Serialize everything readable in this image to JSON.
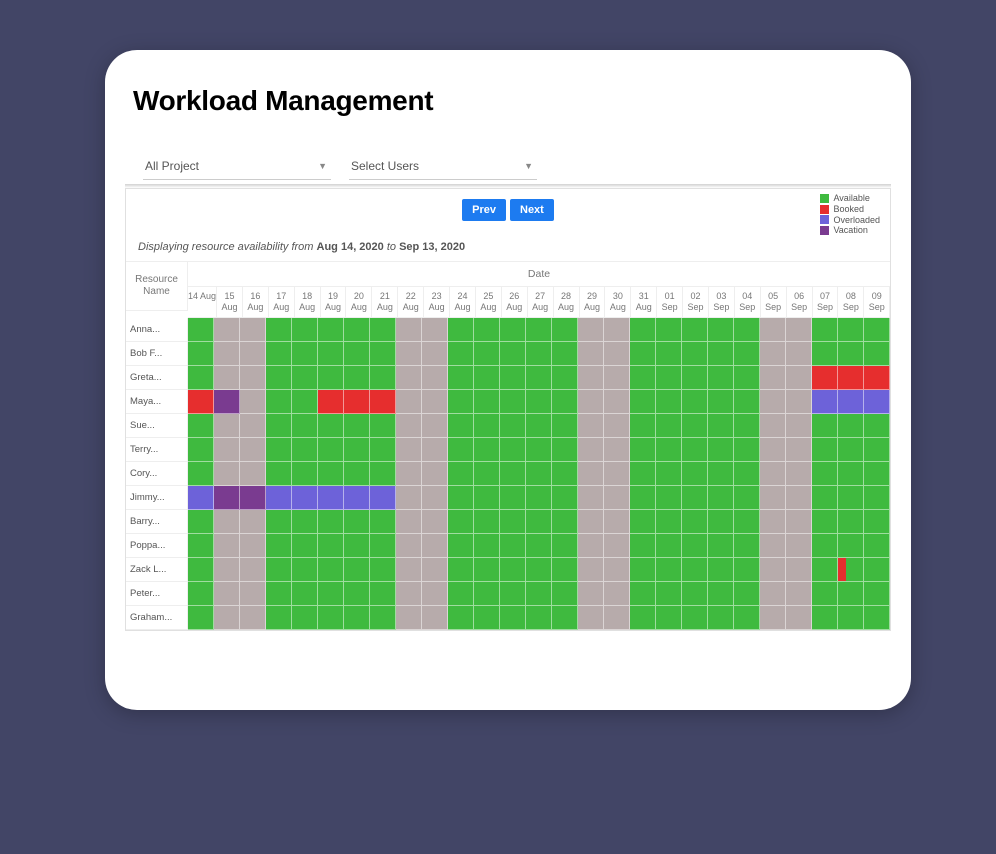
{
  "title": "Workload Management",
  "filters": {
    "project": {
      "label": "All Project"
    },
    "users": {
      "label": "Select Users"
    }
  },
  "nav": {
    "prev": "Prev",
    "next": "Next"
  },
  "legend": [
    {
      "label": "Available",
      "color": "#3fba3f"
    },
    {
      "label": "Booked",
      "color": "#e62e2e"
    },
    {
      "label": "Overloaded",
      "color": "#6d62d9"
    },
    {
      "label": "Vacation",
      "color": "#7a3b90"
    }
  ],
  "caption": {
    "prefix": "Displaying resource availability from ",
    "from": "Aug 14, 2020",
    "mid": " to ",
    "to": "Sep 13, 2020"
  },
  "headers": {
    "resource": "Resource Name",
    "date": "Date"
  },
  "dates": [
    "14 Aug",
    "15 Aug",
    "16 Aug",
    "17 Aug",
    "18 Aug",
    "19 Aug",
    "20 Aug",
    "21 Aug",
    "22 Aug",
    "23 Aug",
    "24 Aug",
    "25 Aug",
    "26 Aug",
    "27 Aug",
    "28 Aug",
    "29 Aug",
    "30 Aug",
    "31 Aug",
    "01 Sep",
    "02 Sep",
    "03 Sep",
    "04 Sep",
    "05 Sep",
    "06 Sep",
    "07 Sep",
    "08 Sep",
    "09 Sep"
  ],
  "weekends": [
    1,
    2,
    8,
    9,
    15,
    16,
    22,
    23
  ],
  "resources": [
    {
      "name": "Anna...",
      "cells": {}
    },
    {
      "name": "Bob F...",
      "cells": {}
    },
    {
      "name": "Greta...",
      "cells": {
        "24": "booked",
        "25": "booked",
        "26": "booked"
      }
    },
    {
      "name": "Maya...",
      "cells": {
        "0": "booked",
        "1": "vacation",
        "5": "booked",
        "6": "booked",
        "7": "booked",
        "24": "overloaded",
        "25": "overloaded",
        "26": "overloaded"
      }
    },
    {
      "name": "Sue...",
      "cells": {}
    },
    {
      "name": "Terry...",
      "cells": {}
    },
    {
      "name": "Cory...",
      "cells": {}
    },
    {
      "name": "Jimmy...",
      "cells": {
        "0": "overloaded",
        "1": "vacation",
        "2": "vacation",
        "3": "overloaded",
        "4": "overloaded",
        "5": "overloaded",
        "6": "overloaded",
        "7": "overloaded"
      }
    },
    {
      "name": "Barry...",
      "cells": {}
    },
    {
      "name": "Poppa...",
      "cells": {}
    },
    {
      "name": "Zack L...",
      "cells": {
        "25": "half"
      }
    },
    {
      "name": "Peter...",
      "cells": {}
    },
    {
      "name": "Graham...",
      "cells": {}
    }
  ]
}
